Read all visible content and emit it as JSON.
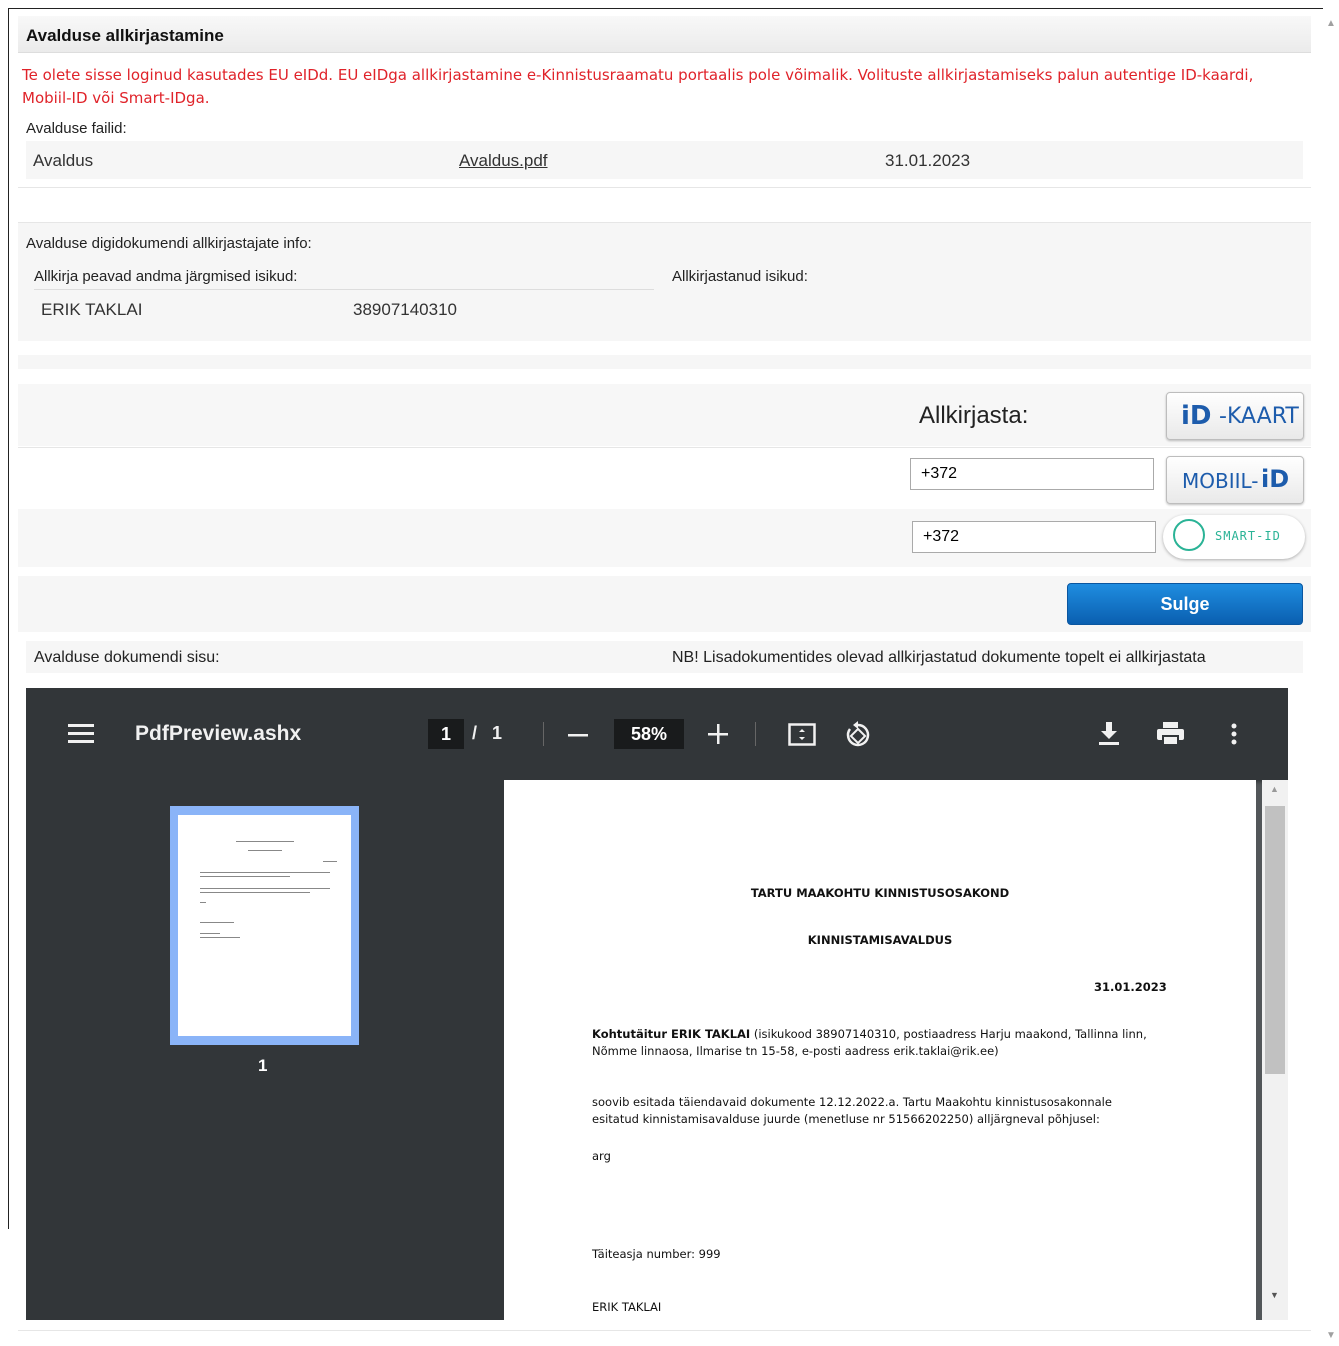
{
  "title": "Avalduse allkirjastamine",
  "warning": "Te olete sisse loginud kasutades EU eIDd. EU eIDga allkirjastamine e-Kinnistusraamatu portaalis pole võimalik. Volituste allkirjastamiseks palun autentige ID-kaardi, Mobiil-ID või Smart-IDga.",
  "files": {
    "label": "Avalduse failid:",
    "row": {
      "name": "Avaldus",
      "link": "Avaldus.pdf",
      "date": "31.01.2023"
    }
  },
  "signers": {
    "section_label": "Avalduse digidokumendi allkirjastajate info:",
    "must_sign_label": "Allkirja peavad andma järgmised isikud:",
    "signed_label": "Allkirjastanud isikud:",
    "person_name": "ERIK TAKLAI",
    "person_code": "38907140310"
  },
  "sign": {
    "label": "Allkirjasta:",
    "idcard_prefix": "iD",
    "idcard_text": "-KAART",
    "mobiil_text": "MOBIIL-",
    "mobiil_suffix": "iD",
    "mobiil_phone": "+372",
    "smart_phone": "+372",
    "smart_text": "SMART-ID",
    "close_label": "Sulge"
  },
  "doc": {
    "content_label": "Avalduse dokumendi sisu:",
    "note": "NB! Lisadokumentides olevad allkirjastatud dokumente topelt ei allkirjastata"
  },
  "viewer": {
    "filename": "PdfPreview.ashx",
    "page_current": "1",
    "page_sep": "/",
    "page_total": "1",
    "zoom": "58%",
    "thumb_number": "1",
    "icons": [
      "menu-icon",
      "minus-icon",
      "plus-icon",
      "fit-page-icon",
      "rotate-icon",
      "download-icon",
      "print-icon",
      "more-icon"
    ]
  },
  "pdf_page": {
    "heading1": "TARTU MAAKOHTU KINNISTUSOSAKOND",
    "heading2": "KINNISTAMISAVALDUS",
    "date": "31.01.2023",
    "para1_bold": "Kohtutäitur ERIK TAKLAI",
    "para1_rest": " (isikukood 38907140310, postiaadress Harju maakond, Tallinna linn,",
    "para1_line2": "Nõmme linnaosa, Ilmarise tn 15-58, e-posti aadress erik.taklai@rik.ee)",
    "para2_line1": "soovib esitada täiendavaid dokumente 12.12.2022.a. Tartu Maakohtu kinnistusosakonnale",
    "para2_line2": "esitatud kinnistamisavalduse juurde (menetluse nr 51566202250) alljärgneval põhjusel:",
    "para3": "arg",
    "execution_number": "Täiteasja number: 999",
    "signer": "ERIK TAKLAI"
  }
}
